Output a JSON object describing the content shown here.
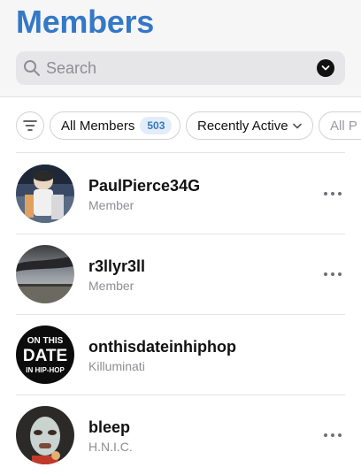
{
  "header": {
    "title": "Members",
    "search": {
      "placeholder": "Search",
      "value": ""
    }
  },
  "filters": {
    "chips": [
      {
        "label": "All Members",
        "count": "503",
        "selected": true
      },
      {
        "label": "Recently Active",
        "has_dropdown": true
      },
      {
        "label": "All P"
      }
    ]
  },
  "members": [
    {
      "name": "PaulPierce34G",
      "role": "Member",
      "avatar": "mascot-photo"
    },
    {
      "name": "r3llyr3ll",
      "role": "Member",
      "avatar": "sky-landscape-photo"
    },
    {
      "name": "onthisdateinhiphop",
      "role": "Killuminati",
      "avatar": "logo-badge",
      "avatar_text": [
        "ON THIS",
        "DATE",
        "IN HIP-HOP"
      ]
    },
    {
      "name": "bleep",
      "role": "H.N.I.C.",
      "avatar": "masked-person-photo"
    }
  ],
  "colors": {
    "title": "#3478c6",
    "badge_bg": "#e3edf8",
    "badge_text": "#3478c6",
    "secondary_text": "#8e8e93"
  },
  "icons": {
    "search": "search-icon",
    "dropdown": "chevron-down-icon",
    "filter": "filter-icon",
    "more": "more-icon"
  }
}
